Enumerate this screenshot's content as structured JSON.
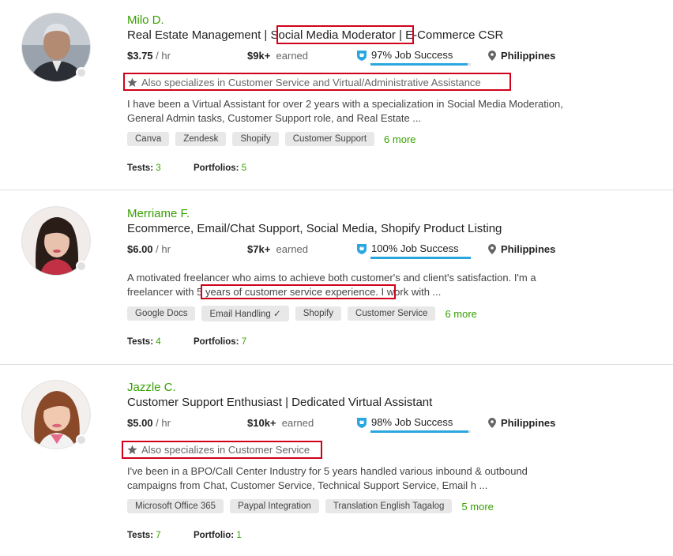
{
  "freelancers": [
    {
      "name": "Milo D.",
      "title_parts": [
        "Real Estate Management | ",
        "Social Media Moderator",
        " | E-Commerce CSR"
      ],
      "rate": "$3.75",
      "rate_unit": "/ hr",
      "earned": "$9k+",
      "earned_label": "earned",
      "job_success": "97% Job Success",
      "job_success_value": 0.97,
      "location": "Philippines",
      "specializes": "Also specializes in Customer Service and Virtual/Administrative Assistance",
      "description": "I have been a Virtual Assistant for over 2 years with a specialization in Social Media Moderation, General Admin tasks, Customer Support role, and Real Estate ...",
      "skills": [
        "Canva",
        "Zendesk",
        "Shopify",
        "Customer Support"
      ],
      "more": "6 more",
      "tests_label": "Tests:",
      "tests": "3",
      "portfolios_label": "Portfolios:",
      "portfolios": "5"
    },
    {
      "name": "Merriame F.",
      "title": "Ecommerce, Email/Chat Support, Social Media, Shopify Product Listing",
      "rate": "$6.00",
      "rate_unit": "/ hr",
      "earned": "$7k+",
      "earned_label": "earned",
      "job_success": "100% Job Success",
      "job_success_value": 1.0,
      "location": "Philippines",
      "description_parts": [
        "A motivated freelancer who aims to achieve both customer's and client's satisfaction. I'm a freelancer with ",
        "5 years of customer service experience.",
        " I work with ..."
      ],
      "skills": [
        "Google Docs",
        "Email Handling",
        "Shopify",
        "Customer Service"
      ],
      "skill_check": "✓",
      "more": "6 more",
      "tests_label": "Tests:",
      "tests": "4",
      "portfolios_label": "Portfolios:",
      "portfolios": "7"
    },
    {
      "name": "Jazzle C.",
      "title": "Customer Support Enthusiast | Dedicated Virtual Assistant",
      "rate": "$5.00",
      "rate_unit": "/ hr",
      "earned": "$10k+",
      "earned_label": "earned",
      "job_success": "98% Job Success",
      "job_success_value": 0.98,
      "location": "Philippines",
      "specializes": "Also specializes in Customer Service",
      "description": "I've been in a BPO/Call Center Industry for 5 years handled various inbound & outbound campaigns from Chat, Customer Service, Technical Support Service, Email h ...",
      "skills": [
        "Microsoft Office 365",
        "Paypal Integration",
        "Translation English Tagalog"
      ],
      "more": "5 more",
      "tests_label": "Tests:",
      "tests": "7",
      "portfolios_label": "Portfolio:",
      "portfolios": "1"
    }
  ],
  "colors": {
    "green": "#37a000",
    "blue": "#2aa7df",
    "highlight": "#d0021b"
  }
}
